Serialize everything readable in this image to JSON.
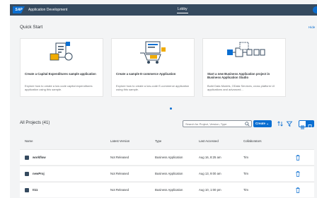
{
  "shell": {
    "logo": "SAP",
    "app_title": "Application Development",
    "tab": "Lobby"
  },
  "quick_start": {
    "title": "Quick Start",
    "hide_label": "Hide",
    "cards": [
      {
        "title": "Create a Capital Expenditures sample application",
        "description": "Explore how to create a low code capital expenditures application using this sample."
      },
      {
        "title": "Create a sample E-commerce Application",
        "description": "Explore how to create a low-code E-commerce application using this sample."
      },
      {
        "title": "Start a new Business Application project in Business Application Studio",
        "description": "Build Data Models, OData Services, cross platform UI applications and advanced..."
      }
    ]
  },
  "projects": {
    "title": "All Projects (41)",
    "search_placeholder": "Search for Project, Version, Type",
    "create_label": "Create ⌄",
    "columns": [
      "Name",
      "Latest Version",
      "Type",
      "Last Accessed",
      "Collaborators"
    ],
    "rows": [
      {
        "name": "workflow",
        "version": "Not Released",
        "type": "Business Application",
        "accessed": "Aug 16, 8:25 am",
        "collaborators": "Tim"
      },
      {
        "name": "newProj",
        "version": "Not Released",
        "type": "Business Application",
        "accessed": "Aug 13, 9:00 am",
        "collaborators": "Tim"
      },
      {
        "name": "tt11",
        "version": "Not Released",
        "type": "Business Application",
        "accessed": "Aug 10, 1:00 pm",
        "collaborators": "Tim"
      }
    ]
  },
  "colors": {
    "shell": "#354a5f",
    "accent": "#0a6ed1",
    "background": "#f3f4f5"
  }
}
